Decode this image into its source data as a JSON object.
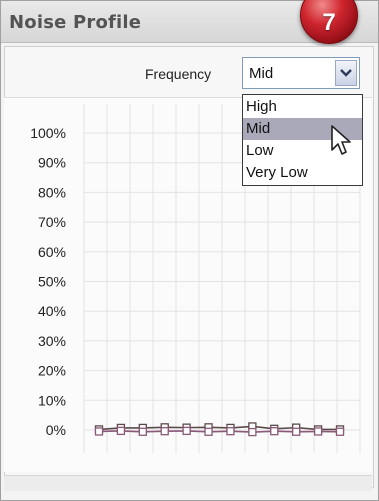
{
  "panel": {
    "title": "Noise Profile",
    "step_number": "7"
  },
  "frequency": {
    "label": "Frequency",
    "selected": "Mid",
    "options": [
      "High",
      "Mid",
      "Low",
      "Very Low"
    ],
    "highlighted_option": "Mid"
  },
  "chart_data": {
    "type": "line",
    "y_ticks": [
      "100%",
      "90%",
      "80%",
      "70%",
      "60%",
      "50%",
      "40%",
      "30%",
      "20%",
      "10%",
      "0%"
    ],
    "ylim": [
      0,
      100
    ],
    "x": [
      1,
      2,
      3,
      4,
      5,
      6,
      7,
      8,
      9,
      10,
      11,
      12
    ],
    "grid": true,
    "series": [
      {
        "values": [
          0.2,
          0.7,
          0.7,
          0.9,
          0.8,
          0.9,
          0.7,
          1.2,
          0.4,
          0.8,
          0.2,
          0.2
        ],
        "color": "#5c4a4a"
      },
      {
        "values": [
          -0.5,
          -0.3,
          -0.6,
          -0.4,
          -0.3,
          -0.6,
          -0.4,
          -0.7,
          -0.4,
          -0.6,
          -0.5,
          -0.6
        ],
        "color": "#8a5a78"
      }
    ]
  },
  "colors": {
    "badge": "#c0202a",
    "selected_item_bg": "#a9a9ba",
    "select_border": "#7f9db9"
  }
}
